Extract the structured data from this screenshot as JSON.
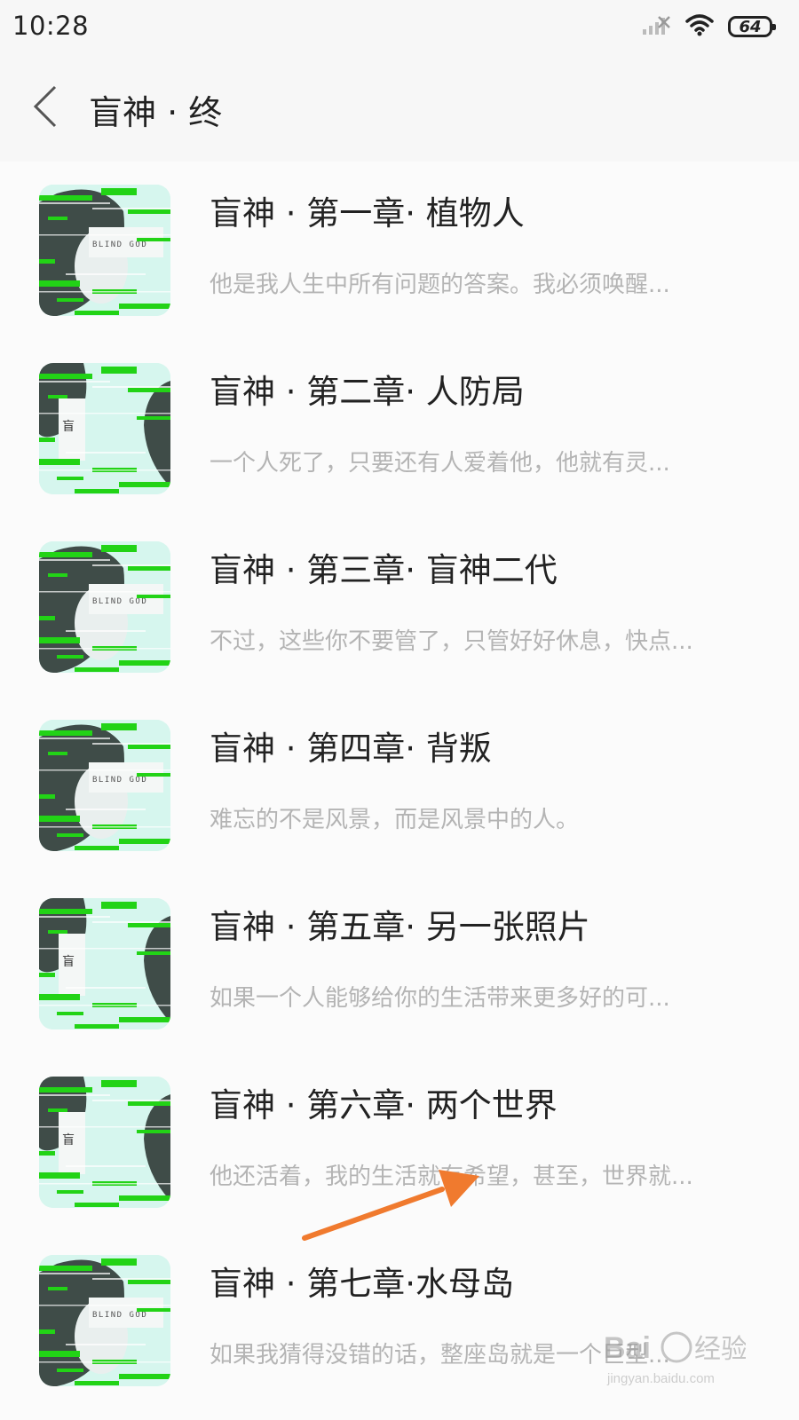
{
  "status_bar": {
    "time": "10:28",
    "battery": "64",
    "signal_icon": "signal-icon",
    "wifi_icon": "wifi-icon"
  },
  "header": {
    "title": "盲神 · 终",
    "back_icon": "chevron-left-icon"
  },
  "cover_art": {
    "text_variant_a": "BLIND GOD",
    "text_variant_b": "盲",
    "accent": "#22d316",
    "tint": "#d6f6ee"
  },
  "chapters": [
    {
      "title": "盲神 · 第一章· 植物人",
      "desc": "他是我人生中所有问题的答案。我必须唤醒..."
    },
    {
      "title": "盲神 · 第二章· 人防局",
      "desc": "一个人死了，只要还有人爱着他，他就有灵..."
    },
    {
      "title": "盲神 · 第三章· 盲神二代",
      "desc": "不过，这些你不要管了，只管好好休息，快点..."
    },
    {
      "title": "盲神 · 第四章· 背叛",
      "desc": "难忘的不是风景，而是风景中的人。"
    },
    {
      "title": "盲神 · 第五章· 另一张照片",
      "desc": "如果一个人能够给你的生活带来更多好的可..."
    },
    {
      "title": "盲神 · 第六章· 两个世界",
      "desc": "他还活着，我的生活就有希望，甚至，世界就..."
    },
    {
      "title": "盲神 · 第七章·水母岛",
      "desc": "如果我猜得没错的话，整座岛就是一个巨型..."
    }
  ],
  "annotation": {
    "arrow_color": "#f07a2e"
  },
  "watermark": {
    "text": "Bai",
    "text_cn": "经验",
    "url": "jingyan.baidu.com"
  }
}
